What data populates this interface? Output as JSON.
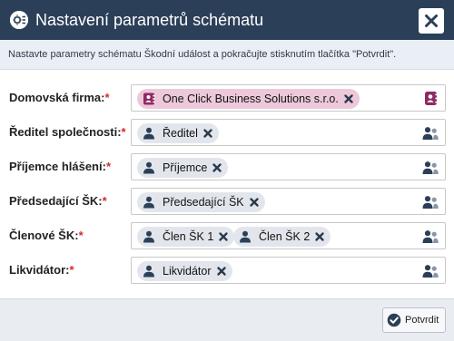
{
  "dialog": {
    "title": "Nastavení parametrů schématu",
    "instruction": "Nastavte parametry schématu Škodní událost a pokračujte stisknutím tlačítka \"Potvrdit\".",
    "confirm_label": "Potvrdit",
    "required_mark": "*"
  },
  "fields": [
    {
      "label": "Domovská firma:",
      "tags": [
        "One Click Business Solutions s.r.o."
      ],
      "tag_icon": "company-icon",
      "picker_icon": "company-picker-icon"
    },
    {
      "label": "Ředitel společnosti:",
      "tags": [
        "Ředitel"
      ],
      "tag_icon": "person-icon",
      "picker_icon": "users-picker-icon"
    },
    {
      "label": "Příjemce hlášení:",
      "tags": [
        "Příjemce"
      ],
      "tag_icon": "person-icon",
      "picker_icon": "users-picker-icon"
    },
    {
      "label": "Předsedající ŠK:",
      "tags": [
        "Předsedající ŠK"
      ],
      "tag_icon": "person-icon",
      "picker_icon": "users-picker-icon"
    },
    {
      "label": "Členové ŠK:",
      "tags": [
        "Člen ŠK 1",
        "Člen ŠK 2"
      ],
      "tag_icon": "person-icon",
      "picker_icon": "users-picker-icon"
    },
    {
      "label": "Likvidátor:",
      "tags": [
        "Likvidátor"
      ],
      "tag_icon": "person-icon",
      "picker_icon": "users-picker-icon"
    }
  ],
  "colors": {
    "titlebar": "#2b3f58",
    "company_tag": "#ecc8da",
    "company_icon": "#8e2a63",
    "person_tag": "#e2e6ec",
    "person_icon": "#2b3f58",
    "required": "#d62a2a"
  }
}
